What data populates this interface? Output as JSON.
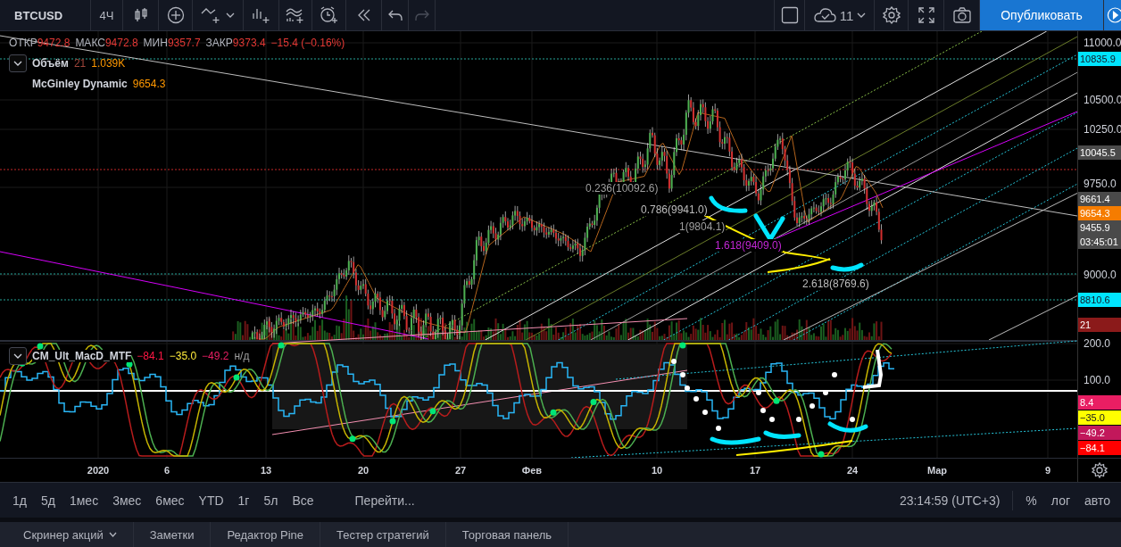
{
  "toolbar": {
    "symbol": "BTCUSD",
    "interval": "4Ч",
    "layout_count": "11",
    "publish_label": "Опубликовать",
    "redo_disabled": true
  },
  "legend": {
    "ohlc": [
      {
        "label": "ОТКР",
        "value": "9472.8"
      },
      {
        "label": "МАКС",
        "value": "9472.8"
      },
      {
        "label": "МИН",
        "value": "9357.7"
      },
      {
        "label": "ЗАКР",
        "value": "9373.4"
      }
    ],
    "change": "−15.4 (−0.16%)",
    "volume": {
      "name": "Объём",
      "length": "21",
      "value": "1.039K"
    },
    "mcginley": {
      "name": "McGinley Dynamic",
      "value": "9654.3"
    }
  },
  "fib_levels": [
    {
      "text": "0.236(10092.6)",
      "color": "#9e9e9e"
    },
    {
      "text": "0.786(9941.0)",
      "color": "#bdbdbd"
    },
    {
      "text": "1(9804.1)",
      "color": "#9e9e9e"
    },
    {
      "text": "1.618(9409.0)",
      "color": "#c026d3"
    },
    {
      "text": "2.618(8769.6)",
      "color": "#bdbdbd"
    }
  ],
  "price_axis": {
    "ticks": [
      "11000.0",
      "10500.0",
      "10250.0",
      "9750.0",
      "9000.0"
    ],
    "tags": [
      {
        "text": "10835.9",
        "color": "#00e5ff"
      },
      {
        "text": "10045.5",
        "color": "#4a4a4a"
      },
      {
        "text": "9661.4",
        "color": "#4a4a4a"
      },
      {
        "text": "9654.3",
        "color": "#f57c00"
      },
      {
        "text": "9455.9",
        "color": "#4a4a4a"
      },
      {
        "text": "03:45:01",
        "color": "#4a4a4a"
      },
      {
        "text": "8810.6",
        "color": "#00e5ff"
      },
      {
        "text": "21",
        "color": "#8b1a1a"
      }
    ]
  },
  "macd": {
    "name": "CM_Ult_MacD_MTF",
    "values": [
      {
        "text": "−84.1",
        "color": "#ff1744"
      },
      {
        "text": "−35.0",
        "color": "#ffeb3b"
      },
      {
        "text": "−49.2",
        "color": "#e91e63"
      },
      {
        "text": "н/д",
        "color": "#9e9e9e"
      }
    ],
    "axis": {
      "ticks": [
        "200.0",
        "100.0"
      ],
      "tags": [
        {
          "text": "8.4",
          "color": "#e91e63"
        },
        {
          "text": "−35.0",
          "color": "#ffff00"
        },
        {
          "text": "−49.2",
          "color": "#c2185b"
        },
        {
          "text": "−84.1",
          "color": "#ff0000"
        }
      ]
    }
  },
  "time_axis": {
    "labels": [
      "2020",
      "6",
      "13",
      "20",
      "27",
      "Фев",
      "10",
      "17",
      "24",
      "Мар",
      "9"
    ]
  },
  "range_bar": {
    "ranges": [
      "1д",
      "5д",
      "1мес",
      "3мес",
      "6мес",
      "YTD",
      "1г",
      "5л",
      "Все"
    ],
    "goto": "Перейти...",
    "clock": "23:14:59 (UTC+3)",
    "percent": "%",
    "log": "лог",
    "auto": "авто"
  },
  "bottom_tabs": [
    {
      "label": "Скринер акций",
      "dropdown": true
    },
    {
      "label": "Заметки",
      "dropdown": false
    },
    {
      "label": "Редактор Pine",
      "dropdown": false
    },
    {
      "label": "Тестер стратегий",
      "dropdown": false
    },
    {
      "label": "Торговая панель",
      "dropdown": false
    }
  ]
}
